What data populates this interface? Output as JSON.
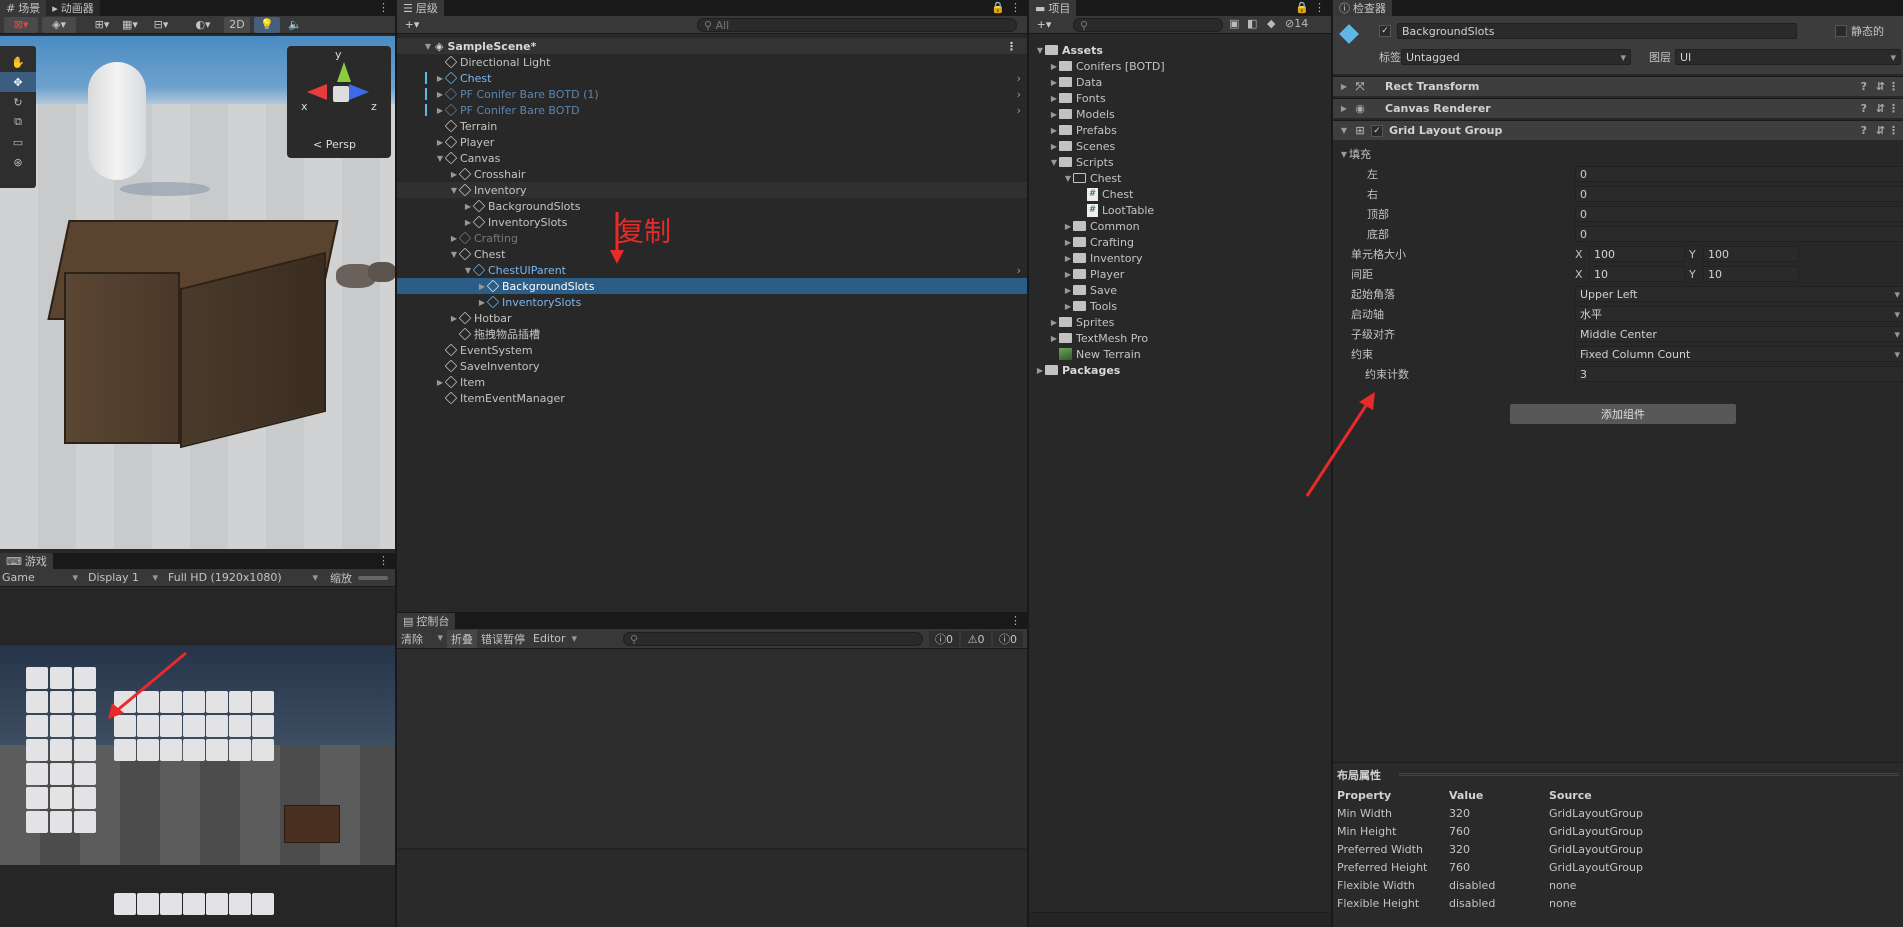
{
  "scene": {
    "tabs": [
      "场景",
      "动画器"
    ],
    "toolbar": {
      "mode2d": "2D"
    },
    "gizmo": {
      "axis_y": "y",
      "axis_x": "x",
      "axis_z": "z",
      "persp": "Persp"
    }
  },
  "game": {
    "tab": "游戏",
    "toolbar": {
      "game": "Game",
      "display": "Display 1",
      "resolution": "Full HD (1920x1080)",
      "scale": "缩放"
    }
  },
  "hierarchy": {
    "tab": "层级",
    "search_placeholder": "All",
    "scene_name": "SampleScene*",
    "items": [
      {
        "label": "Directional Light",
        "indent": 0,
        "expand": "",
        "style": "normal"
      },
      {
        "label": "Chest",
        "indent": 0,
        "expand": "▶",
        "style": "prefab"
      },
      {
        "label": "PF Conifer Bare BOTD (1)",
        "indent": 0,
        "expand": "▶",
        "style": "prefab-dim"
      },
      {
        "label": "PF Conifer Bare BOTD",
        "indent": 0,
        "expand": "▶",
        "style": "prefab-dim"
      },
      {
        "label": "Terrain",
        "indent": 0,
        "expand": "",
        "style": "normal"
      },
      {
        "label": "Player",
        "indent": 0,
        "expand": "▶",
        "style": "normal"
      },
      {
        "label": "Canvas",
        "indent": 0,
        "expand": "▼",
        "style": "normal"
      },
      {
        "label": "Crosshair",
        "indent": 1,
        "expand": "▶",
        "style": "normal"
      },
      {
        "label": "Inventory",
        "indent": 1,
        "expand": "▼",
        "style": "normal"
      },
      {
        "label": "BackgroundSlots",
        "indent": 2,
        "expand": "▶",
        "style": "normal"
      },
      {
        "label": "InventorySlots",
        "indent": 2,
        "expand": "▶",
        "style": "normal"
      },
      {
        "label": "Crafting",
        "indent": 1,
        "expand": "▶",
        "style": "disabled"
      },
      {
        "label": "Chest",
        "indent": 1,
        "expand": "▼",
        "style": "normal"
      },
      {
        "label": "ChestUIParent",
        "indent": 2,
        "expand": "▼",
        "style": "prefab"
      },
      {
        "label": "BackgroundSlots",
        "indent": 3,
        "expand": "▶",
        "style": "selected"
      },
      {
        "label": "InventorySlots",
        "indent": 3,
        "expand": "▶",
        "style": "prefab"
      },
      {
        "label": "Hotbar",
        "indent": 1,
        "expand": "▶",
        "style": "normal"
      },
      {
        "label": "拖拽物品插槽",
        "indent": 1,
        "expand": "",
        "style": "normal"
      },
      {
        "label": "EventSystem",
        "indent": 0,
        "expand": "",
        "style": "normal"
      },
      {
        "label": "SaveInventory",
        "indent": 0,
        "expand": "",
        "style": "normal"
      },
      {
        "label": "Item",
        "indent": 0,
        "expand": "▶",
        "style": "normal"
      },
      {
        "label": "ItemEventManager",
        "indent": 0,
        "expand": "",
        "style": "normal"
      }
    ],
    "annotation": "复制"
  },
  "console": {
    "tab": "控制台",
    "clear": "清除",
    "collapse": "折叠",
    "error_pause": "错误暂停",
    "editor": "Editor",
    "counts": [
      "0",
      "0",
      "0"
    ]
  },
  "project": {
    "tab": "项目",
    "hidden_count": "14",
    "items": [
      {
        "label": "Assets",
        "indent": 0,
        "expand": "▼",
        "icon": "folder",
        "bold": true
      },
      {
        "label": "Conifers [BOTD]",
        "indent": 1,
        "expand": "▶",
        "icon": "folder",
        "bold": false
      },
      {
        "label": "Data",
        "indent": 1,
        "expand": "▶",
        "icon": "folder",
        "bold": false
      },
      {
        "label": "Fonts",
        "indent": 1,
        "expand": "▶",
        "icon": "folder",
        "bold": false
      },
      {
        "label": "Models",
        "indent": 1,
        "expand": "▶",
        "icon": "folder",
        "bold": false
      },
      {
        "label": "Prefabs",
        "indent": 1,
        "expand": "▶",
        "icon": "folder",
        "bold": false
      },
      {
        "label": "Scenes",
        "indent": 1,
        "expand": "▶",
        "icon": "folder",
        "bold": false
      },
      {
        "label": "Scripts",
        "indent": 1,
        "expand": "▼",
        "icon": "folder",
        "bold": false
      },
      {
        "label": "Chest",
        "indent": 2,
        "expand": "▼",
        "icon": "folder-open",
        "bold": false
      },
      {
        "label": "Chest",
        "indent": 3,
        "expand": "",
        "icon": "script",
        "bold": false
      },
      {
        "label": "LootTable",
        "indent": 3,
        "expand": "",
        "icon": "script",
        "bold": false
      },
      {
        "label": "Common",
        "indent": 2,
        "expand": "▶",
        "icon": "folder",
        "bold": false
      },
      {
        "label": "Crafting",
        "indent": 2,
        "expand": "▶",
        "icon": "folder",
        "bold": false
      },
      {
        "label": "Inventory",
        "indent": 2,
        "expand": "▶",
        "icon": "folder",
        "bold": false
      },
      {
        "label": "Player",
        "indent": 2,
        "expand": "▶",
        "icon": "folder",
        "bold": false
      },
      {
        "label": "Save",
        "indent": 2,
        "expand": "▶",
        "icon": "folder",
        "bold": false
      },
      {
        "label": "Tools",
        "indent": 2,
        "expand": "▶",
        "icon": "folder",
        "bold": false
      },
      {
        "label": "Sprites",
        "indent": 1,
        "expand": "▶",
        "icon": "folder",
        "bold": false
      },
      {
        "label": "TextMesh Pro",
        "indent": 1,
        "expand": "▶",
        "icon": "folder",
        "bold": false
      },
      {
        "label": "New Terrain",
        "indent": 1,
        "expand": "",
        "icon": "terrain",
        "bold": false
      },
      {
        "label": "Packages",
        "indent": 0,
        "expand": "▶",
        "icon": "folder",
        "bold": true
      }
    ]
  },
  "inspector": {
    "tab": "检查器",
    "object_name": "BackgroundSlots",
    "static_label": "静态的",
    "tag_label": "标签",
    "tag_value": "Untagged",
    "layer_label": "图层",
    "layer_value": "UI",
    "components": [
      "Rect Transform",
      "Canvas Renderer",
      "Grid Layout Group"
    ],
    "padding": {
      "label": "填充",
      "left_label": "左",
      "left": "0",
      "right_label": "右",
      "right": "0",
      "top_label": "顶部",
      "top": "0",
      "bottom_label": "底部",
      "bottom": "0"
    },
    "cell_size": {
      "label": "单元格大小",
      "x_label": "X",
      "x": "100",
      "y_label": "Y",
      "y": "100"
    },
    "spacing": {
      "label": "间距",
      "x_label": "X",
      "x": "10",
      "y_label": "Y",
      "y": "10"
    },
    "start_corner": {
      "label": "起始角落",
      "value": "Upper Left"
    },
    "start_axis": {
      "label": "启动轴",
      "value": "水平"
    },
    "child_alignment": {
      "label": "子级对齐",
      "value": "Middle Center"
    },
    "constraint": {
      "label": "约束",
      "value": "Fixed Column Count"
    },
    "constraint_count": {
      "label": "约束计数",
      "value": "3"
    },
    "add_component": "添加组件",
    "layout_props": {
      "title": "布局属性",
      "headers": [
        "Property",
        "Value",
        "Source"
      ],
      "rows": [
        [
          "Min Width",
          "320",
          "GridLayoutGroup"
        ],
        [
          "Min Height",
          "760",
          "GridLayoutGroup"
        ],
        [
          "Preferred Width",
          "320",
          "GridLayoutGroup"
        ],
        [
          "Preferred Height",
          "760",
          "GridLayoutGroup"
        ],
        [
          "Flexible Width",
          "disabled",
          "none"
        ],
        [
          "Flexible Height",
          "disabled",
          "none"
        ]
      ]
    }
  },
  "colors": {
    "accent_red": "#e82a2a",
    "selection": "#2c5d87",
    "prefab_blue": "#7cb6ef"
  }
}
